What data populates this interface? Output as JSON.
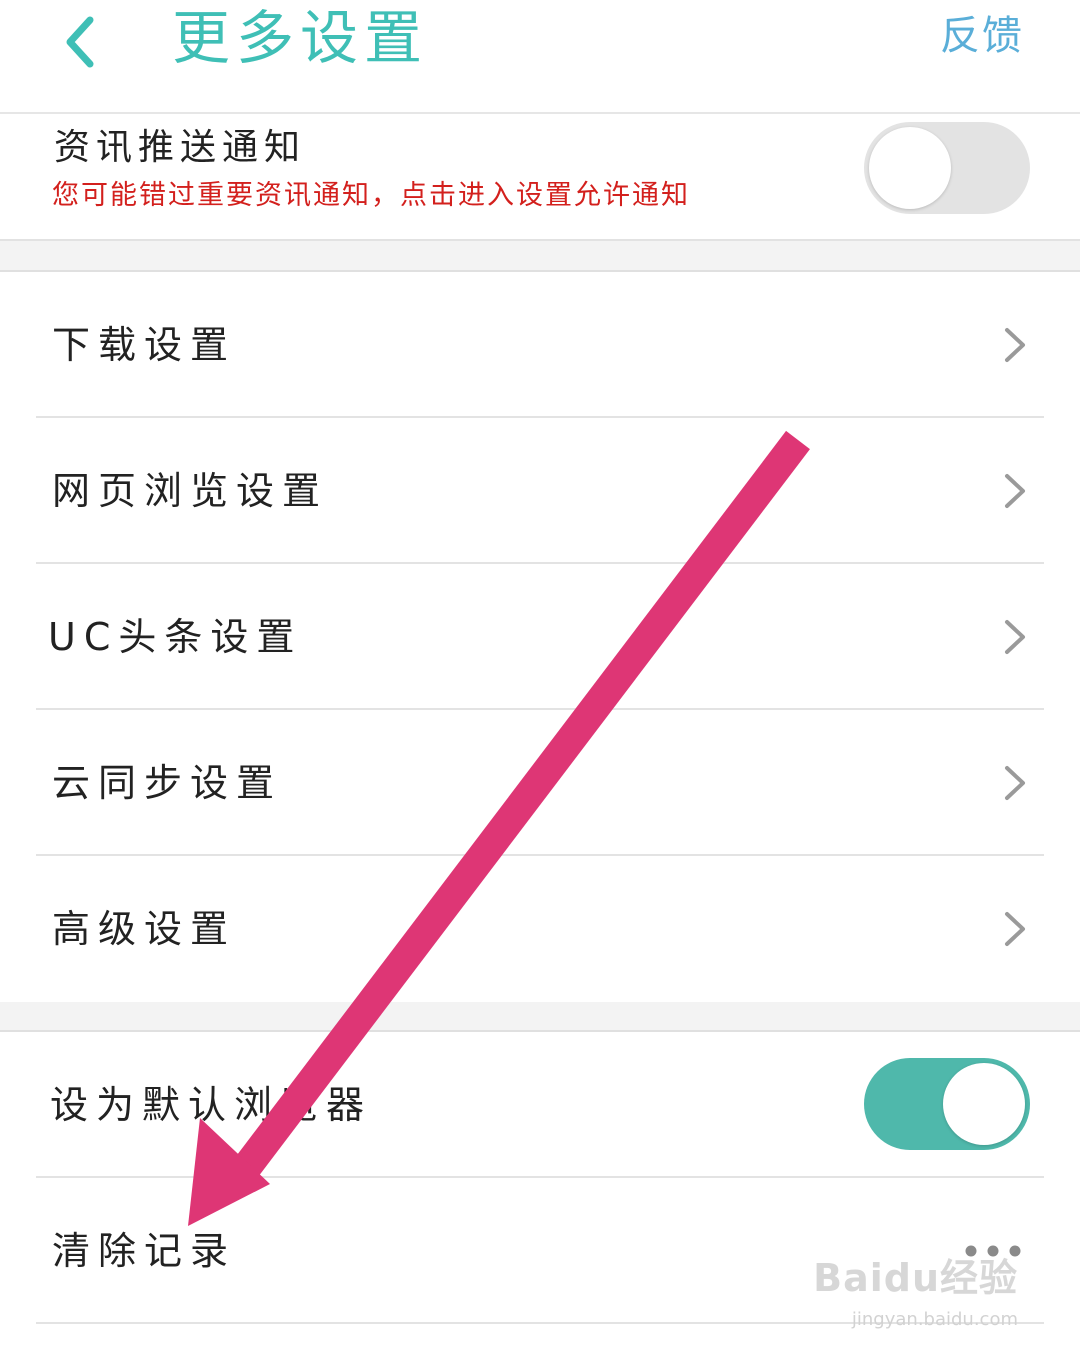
{
  "header": {
    "title": "更多设置",
    "feedback_label": "反馈"
  },
  "notification": {
    "title": "资讯推送通知",
    "warning": "您可能错过重要资讯通知，点击进入设置允许通知",
    "toggle_on": false
  },
  "settings_items": [
    {
      "label": "下载设置"
    },
    {
      "label": "网页浏览设置"
    },
    {
      "label": "UC头条设置"
    },
    {
      "label": "云同步设置"
    },
    {
      "label": "高级设置"
    }
  ],
  "default_browser": {
    "label": "设为默认浏览器",
    "toggle_on": true
  },
  "clear_records": {
    "label": "清除记录"
  },
  "watermark": {
    "logo": "Baidu经验",
    "url": "jingyan.baidu.com"
  },
  "colors": {
    "accent": "#3fbfb6",
    "toggle_on": "#4fb8ab",
    "feedback": "#5aaed8",
    "warning": "#d3201d",
    "arrow": "#de3675"
  }
}
